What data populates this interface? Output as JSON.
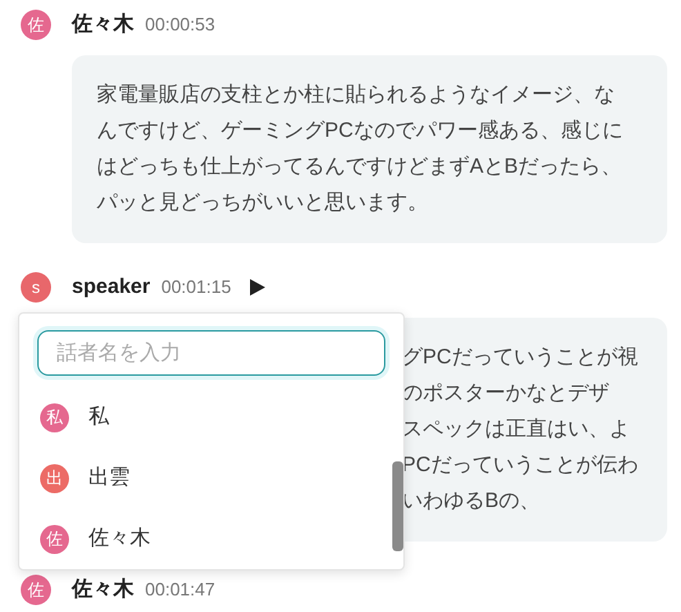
{
  "messages": [
    {
      "avatar": "佐",
      "color": "#e5688f",
      "speaker": "佐々木",
      "time": "00:00:53",
      "lines": [
        "家電量販店の支柱とか柱に貼られるようなイメージ、な",
        "んですけど、ゲーミングPCなのでパワー感ある、感じに",
        "はどっちも仕上がってるんですけどまずAとBだったら、",
        "パッと見どっちがいいと思います。"
      ]
    },
    {
      "avatar": "s",
      "color": "#e8676b",
      "speaker": "speaker",
      "time": "00:01:15",
      "play": true,
      "lines": [
        "グPCだっていうことが視",
        "のポスターかなとデザ",
        "スペックは正直はい、よ",
        "PCだっていうことが伝わ",
        "いわゆるBの、"
      ]
    },
    {
      "avatar": "佐",
      "color": "#e5688f",
      "speaker": "佐々木",
      "time": "00:01:47"
    }
  ],
  "speaker_menu": {
    "placeholder": "話者名を入力",
    "options": [
      {
        "avatar": "私",
        "color": "#e5688f",
        "name": "私"
      },
      {
        "avatar": "出",
        "color": "#ec6b66",
        "name": "出雲"
      },
      {
        "avatar": "佐",
        "color": "#e5688f",
        "name": "佐々木"
      }
    ]
  }
}
